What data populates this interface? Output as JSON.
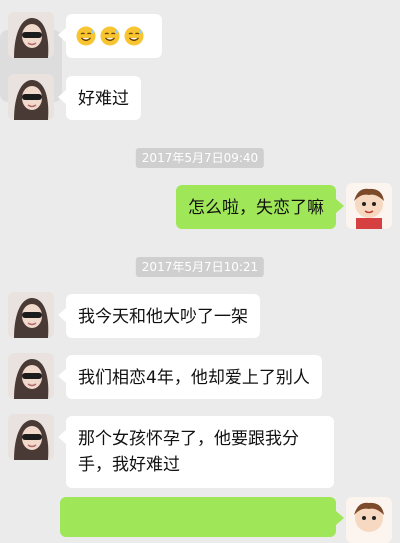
{
  "chat": {
    "timestamps": [
      "2017年5月7日09:40",
      "2017年5月7日10:21"
    ],
    "messages": [
      {
        "side": "left",
        "kind": "emoji",
        "emojis": [
          "sweat-smile-emoji",
          "sweat-smile-emoji",
          "sweat-smile-emoji"
        ]
      },
      {
        "side": "left",
        "text": "好难过"
      },
      {
        "side": "right",
        "text": "怎么啦，失恋了嘛"
      },
      {
        "side": "left",
        "text": "我今天和他大吵了一架"
      },
      {
        "side": "left",
        "text": "我们相恋4年，他却爱上了别人"
      },
      {
        "side": "left",
        "text": "那个女孩怀孕了，他要跟我分手，我好难过"
      },
      {
        "side": "right",
        "text": ""
      }
    ]
  },
  "colors": {
    "background": "#ebebeb",
    "incoming_bubble": "#ffffff",
    "outgoing_bubble": "#9fe658",
    "timestamp_bg": "#cfcfcf"
  }
}
